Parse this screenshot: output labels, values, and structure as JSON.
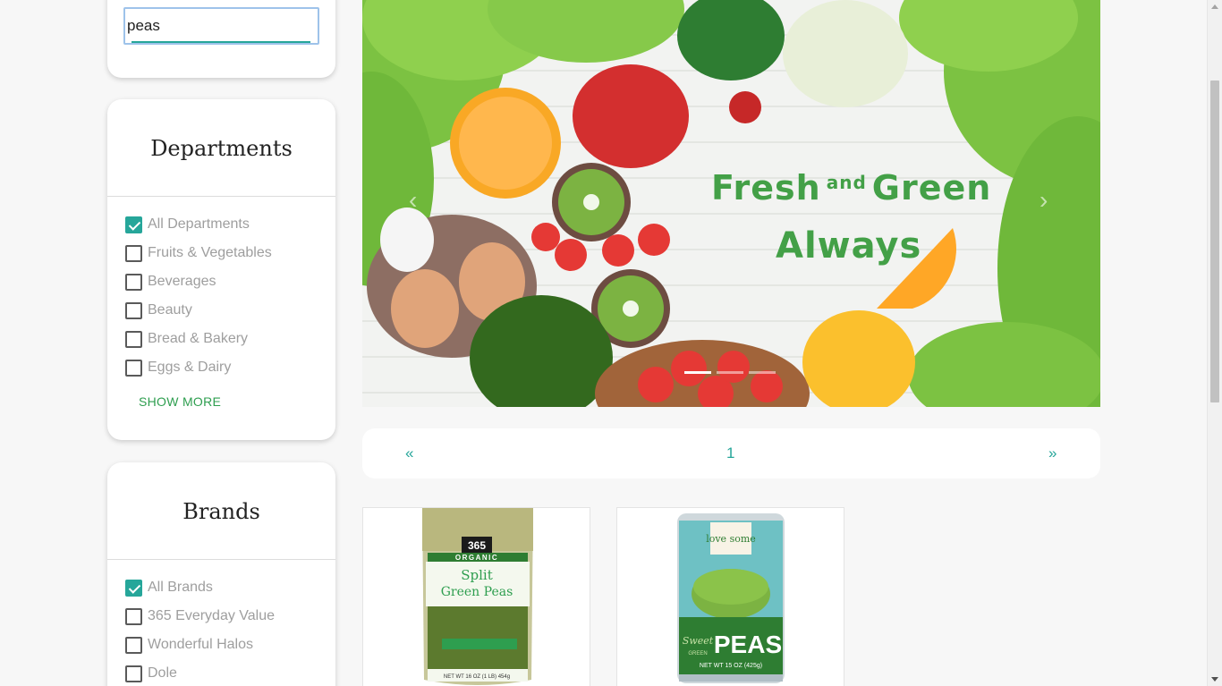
{
  "search": {
    "value": "peas"
  },
  "departments": {
    "title": "Departments",
    "items": [
      {
        "label": "All Departments",
        "checked": true
      },
      {
        "label": "Fruits & Vegetables",
        "checked": false
      },
      {
        "label": "Beverages",
        "checked": false
      },
      {
        "label": "Beauty",
        "checked": false
      },
      {
        "label": "Bread & Bakery",
        "checked": false
      },
      {
        "label": "Eggs & Dairy",
        "checked": false
      }
    ],
    "show_more": "SHOW MORE"
  },
  "brands": {
    "title": "Brands",
    "items": [
      {
        "label": "All Brands",
        "checked": true
      },
      {
        "label": "365 Everyday Value",
        "checked": false
      },
      {
        "label": "Wonderful Halos",
        "checked": false
      },
      {
        "label": "Dole",
        "checked": false
      }
    ]
  },
  "hero": {
    "line1_a": "Fresh",
    "line1_b": "and",
    "line1_c": "Green",
    "line2": "Always",
    "prev_icon": "‹",
    "next_icon": "›",
    "slide_count": 3,
    "active_slide": 1
  },
  "pagination": {
    "prev": "«",
    "current": "1",
    "next": "»"
  },
  "products": [
    {
      "brand_mark": "365",
      "line1": "ORGANIC",
      "line2": "Split",
      "line3": "Green Peas",
      "net_wt": "NET WT 16 OZ (1 LB) 454g"
    },
    {
      "brand_mark": "love some",
      "line1": "Sweet",
      "line2": "GREEN",
      "line3": "PEAS",
      "net_wt": "NET WT 15 OZ (425g)"
    }
  ],
  "colors": {
    "accent": "#26a69a",
    "green_text": "#43a047",
    "link_green": "#2e9e4f"
  }
}
